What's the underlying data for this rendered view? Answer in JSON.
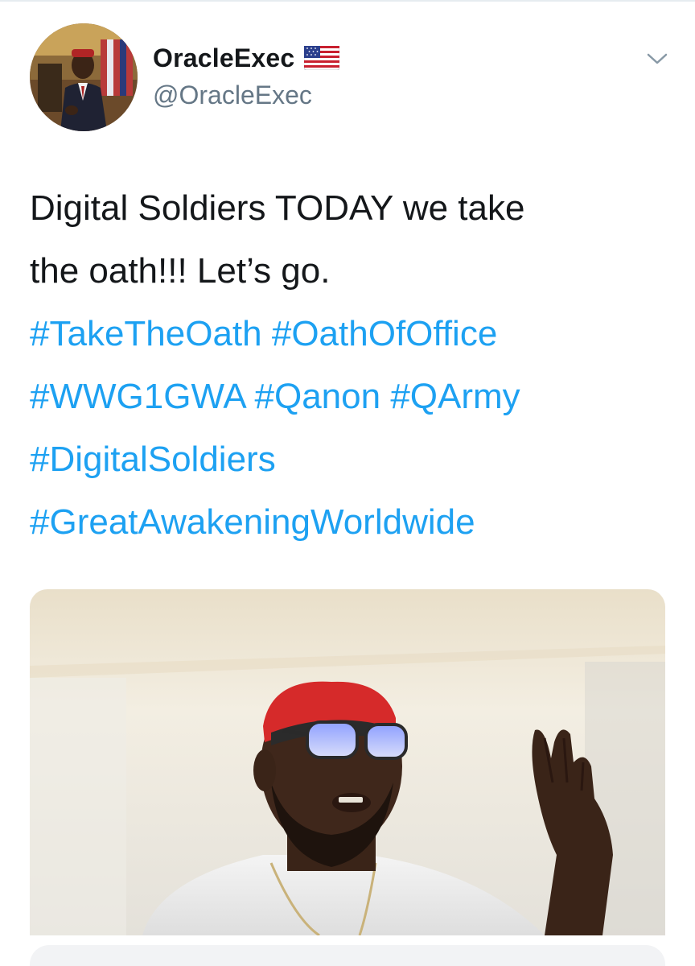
{
  "author": {
    "display_name": "OracleExec",
    "handle": "@OracleExec",
    "flag_icon": "us-flag-icon"
  },
  "tweet": {
    "text_line1": "Digital Soldiers TODAY we take",
    "text_line2": "the oath!!! Let’s go.",
    "hashtags": [
      "#TakeTheOath",
      "#OathOfOffice",
      "#WWG1GWA",
      "#Qanon",
      "#QArmy",
      "#DigitalSoldiers",
      "#GreatAwakeningWorldwide"
    ]
  },
  "colors": {
    "hashtag": "#1da1f2",
    "text": "#14171a",
    "secondary": "#657786"
  }
}
